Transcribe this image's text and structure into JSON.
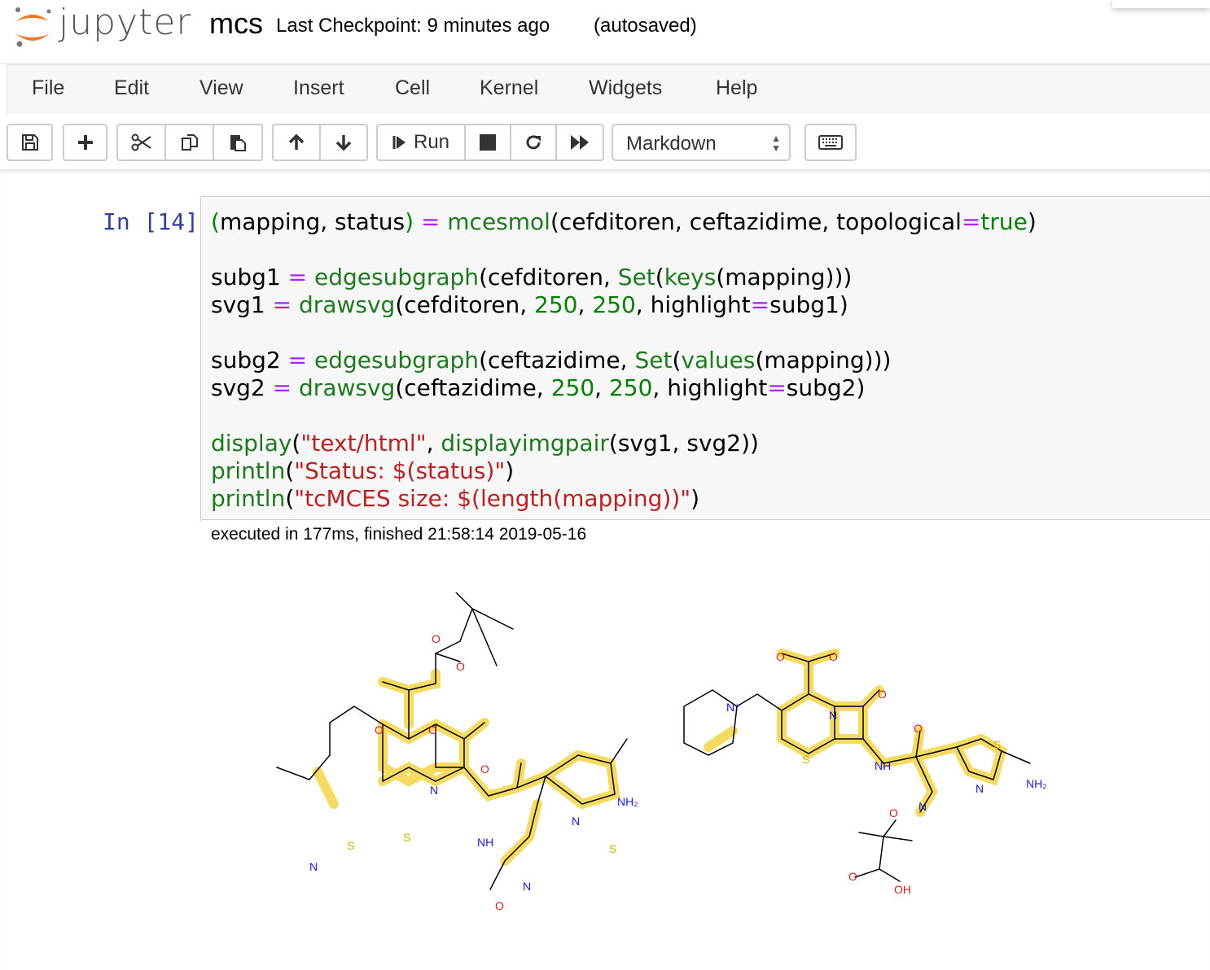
{
  "header": {
    "logo_text": "jupyter",
    "notebook_name": "mcs",
    "checkpoint": "Last Checkpoint: 9 minutes ago",
    "autosave_status": "(autosaved)"
  },
  "menu": [
    "File",
    "Edit",
    "View",
    "Insert",
    "Cell",
    "Kernel",
    "Widgets",
    "Help"
  ],
  "toolbar": {
    "run_label": "Run",
    "cell_type": "Markdown"
  },
  "cell": {
    "prompt": "In [14]:",
    "execution_info": "executed in 177ms, finished 21:58:14 2019-05-16"
  },
  "output": {
    "mol1_atoms": [
      "O",
      "O",
      "O",
      "O",
      "N",
      "O",
      "NH₂",
      "S",
      "S",
      "N",
      "NH",
      "N",
      "N",
      "O",
      "S"
    ],
    "mol2_atoms": [
      "O⁻",
      "O",
      "N⁺",
      "N",
      "O",
      "S",
      "NH",
      "O",
      "S",
      "N",
      "NH₂",
      "N",
      "O",
      "O",
      "OH"
    ]
  }
}
